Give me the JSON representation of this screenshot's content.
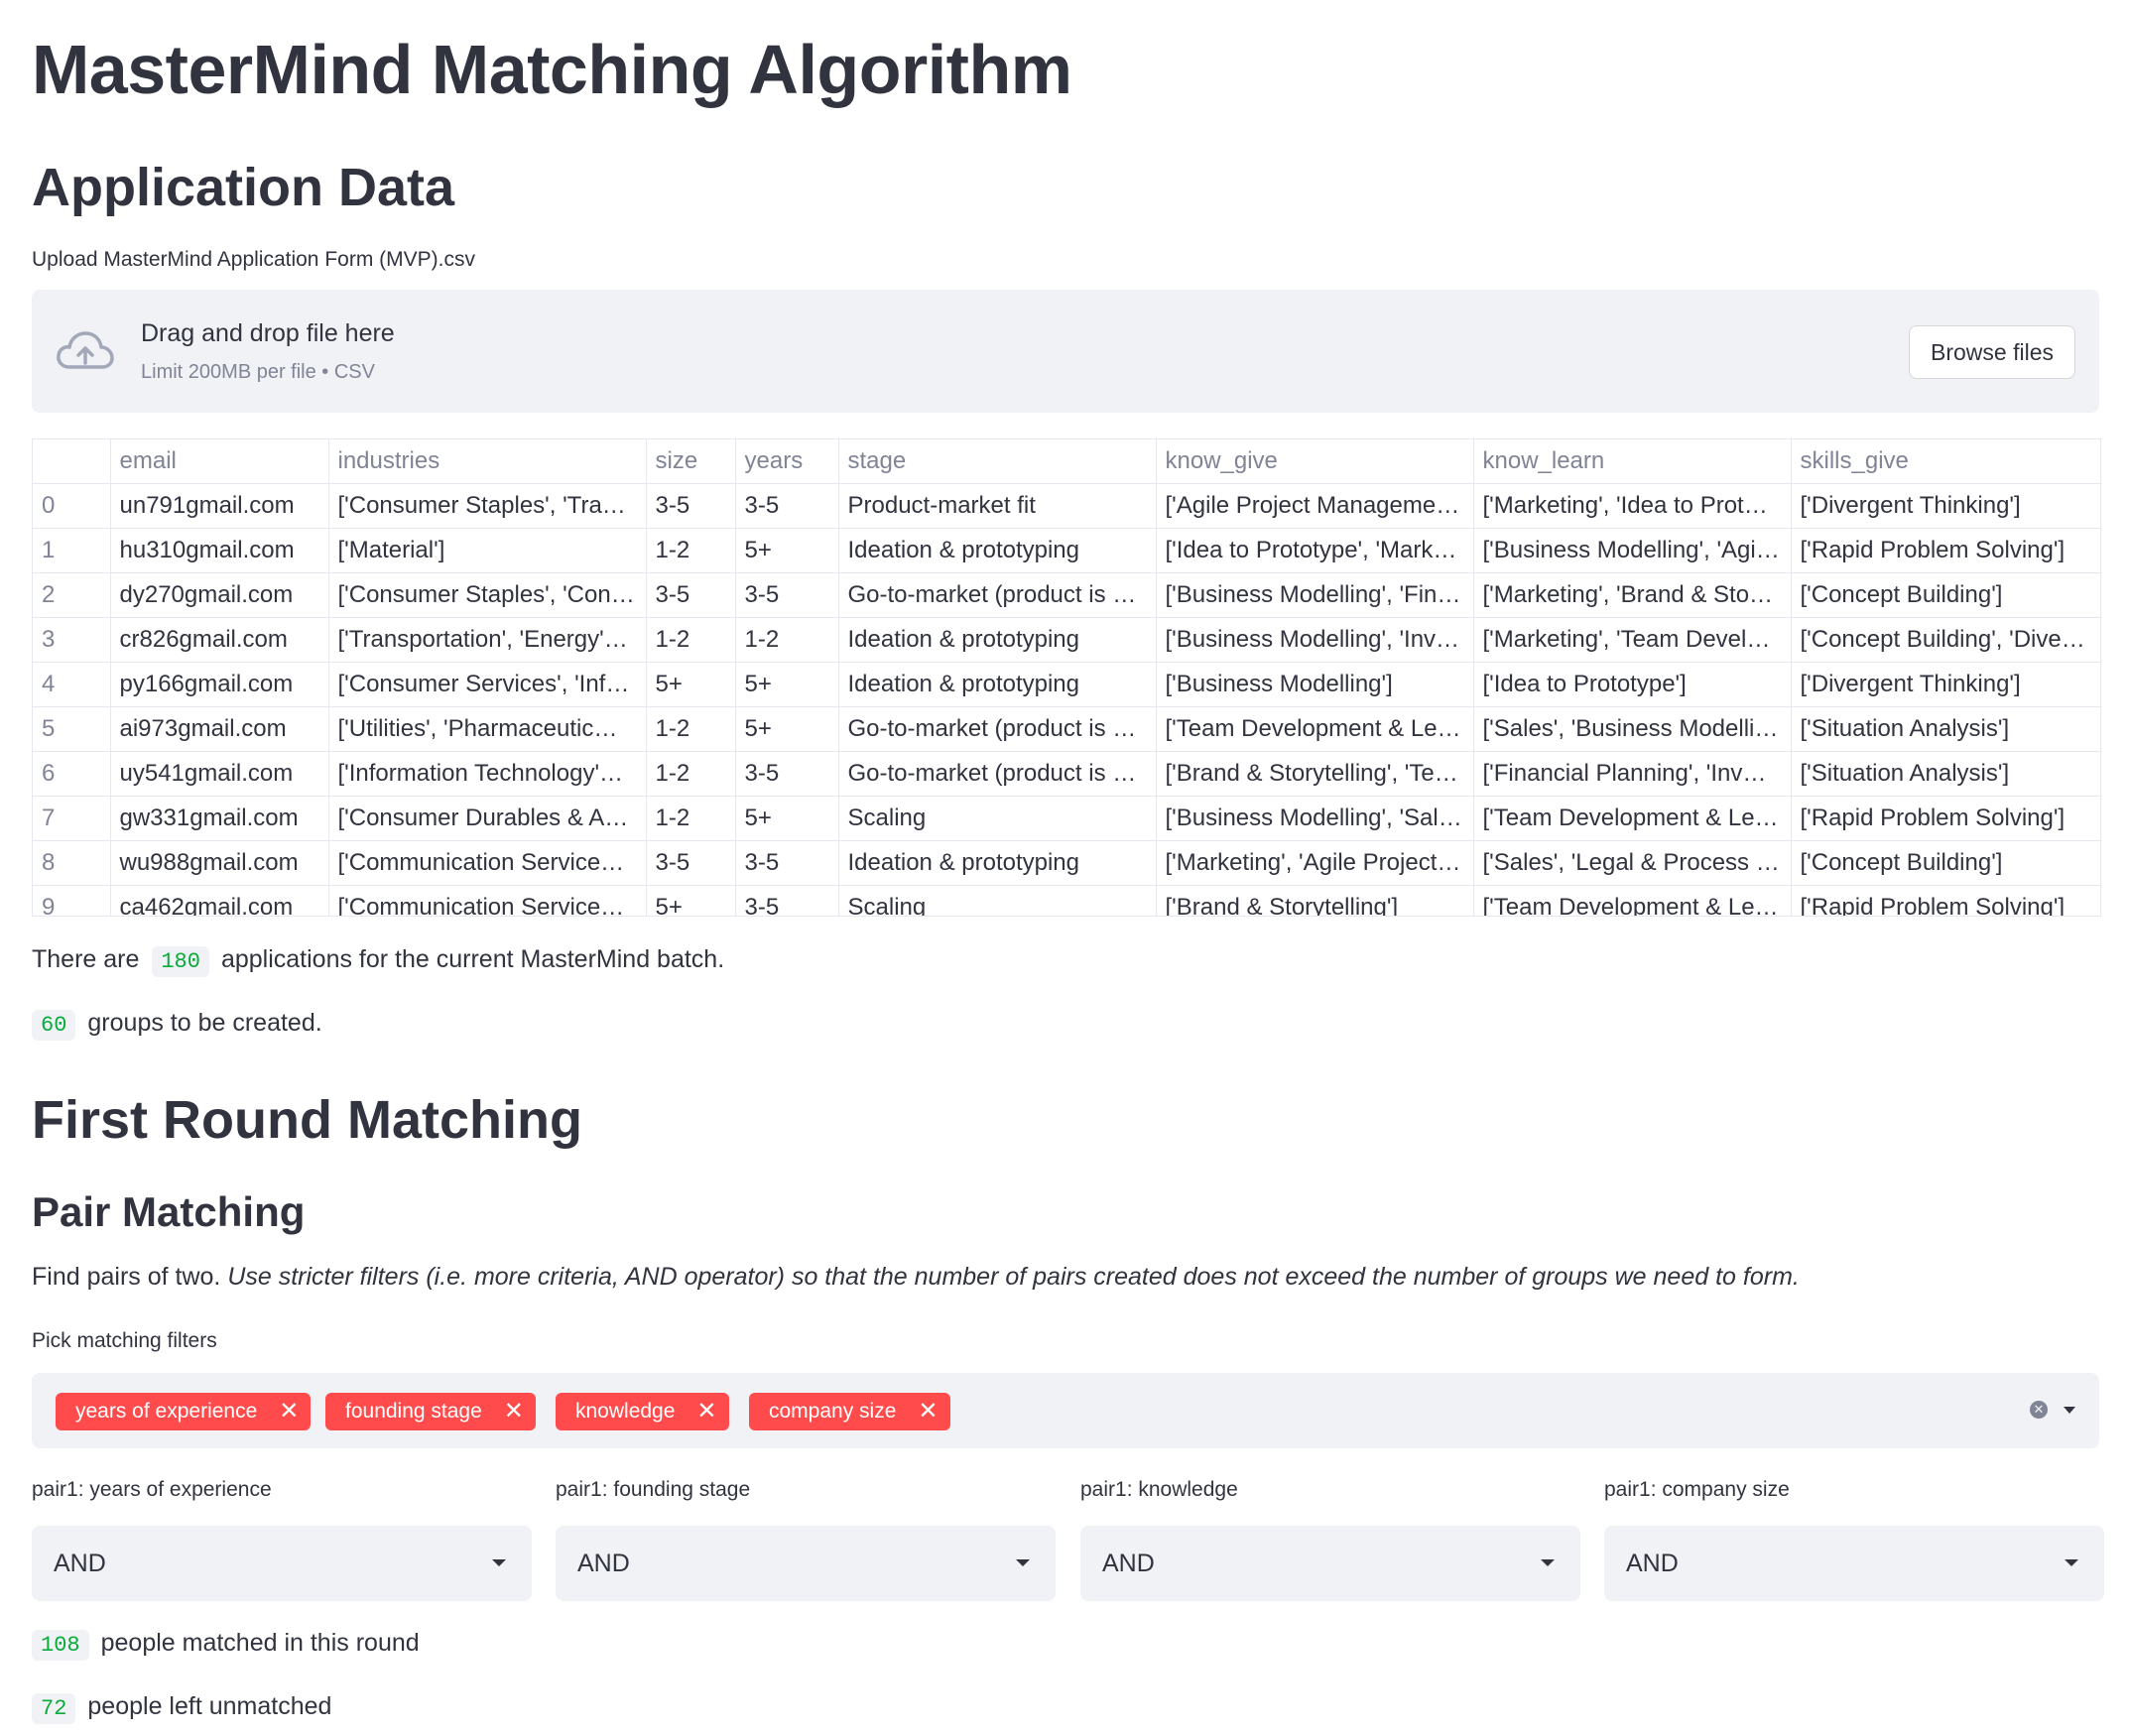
{
  "page": {
    "title": "MasterMind Matching Algorithm",
    "section_application": "Application Data"
  },
  "uploader": {
    "label": "Upload MasterMind Application Form (MVP).csv",
    "drop_title": "Drag and drop file here",
    "drop_sub": "Limit 200MB per file • CSV",
    "browse_label": "Browse files",
    "icon": "cloud-upload-icon"
  },
  "table": {
    "columns": [
      "",
      "email",
      "industries",
      "size",
      "years",
      "stage",
      "know_give",
      "know_learn",
      "skills_give"
    ],
    "rows": [
      [
        "0",
        "un791gmail.com",
        "['Consumer Staples', 'Tra…",
        "3-5",
        "3-5",
        "Product-market fit",
        "['Agile Project Manageme…",
        "['Marketing', 'Idea to Prot…",
        "['Divergent Thinking']"
      ],
      [
        "1",
        "hu310gmail.com",
        "['Material']",
        "1-2",
        "5+",
        "Ideation & prototyping",
        "['Idea to Prototype', 'Mark…",
        "['Business Modelling', 'Agi…",
        "['Rapid Problem Solving']"
      ],
      [
        "2",
        "dy270gmail.com",
        "['Consumer Staples', 'Con…",
        "3-5",
        "3-5",
        "Go-to-market (product is …",
        "['Business Modelling', 'Fin…",
        "['Marketing', 'Brand & Sto…",
        "['Concept Building']"
      ],
      [
        "3",
        "cr826gmail.com",
        "['Transportation', 'Energy'…",
        "1-2",
        "1-2",
        "Ideation & prototyping",
        "['Business Modelling', 'Inv…",
        "['Marketing', 'Team Devel…",
        "['Concept Building', 'Diver…"
      ],
      [
        "4",
        "py166gmail.com",
        "['Consumer Services', 'Inf…",
        "5+",
        "5+",
        "Ideation & prototyping",
        "['Business Modelling']",
        "['Idea to Prototype']",
        "['Divergent Thinking']"
      ],
      [
        "5",
        "ai973gmail.com",
        "['Utilities', 'Pharmaceutic…",
        "1-2",
        "5+",
        "Go-to-market (product is …",
        "['Team Development & Le…",
        "['Sales', 'Business Modelli…",
        "['Situation Analysis']"
      ],
      [
        "6",
        "uy541gmail.com",
        "['Information Technology'…",
        "1-2",
        "3-5",
        "Go-to-market (product is …",
        "['Brand & Storytelling', 'Te…",
        "['Financial Planning', 'Inv…",
        "['Situation Analysis']"
      ],
      [
        "7",
        "gw331gmail.com",
        "['Consumer Durables & A…",
        "1-2",
        "5+",
        "Scaling",
        "['Business Modelling', 'Sal…",
        "['Team Development & Le…",
        "['Rapid Problem Solving']"
      ],
      [
        "8",
        "wu988gmail.com",
        "['Communication Service…",
        "3-5",
        "3-5",
        "Ideation & prototyping",
        "['Marketing', 'Agile Project…",
        "['Sales', 'Legal & Process …",
        "['Concept Building']"
      ],
      [
        "9",
        "ca462gmail.com",
        "['Communication Service…",
        "5+",
        "3-5",
        "Scaling",
        "['Brand & Storytelling']",
        "['Team Development & Le…",
        "['Rapid Problem Solving']"
      ]
    ]
  },
  "stats": {
    "applications_prefix": "There are",
    "applications_count": "180",
    "applications_suffix": "applications for the current MasterMind batch.",
    "groups_count": "60",
    "groups_suffix": "groups to be created."
  },
  "first_round": {
    "title": "First Round Matching",
    "subtitle": "Pair Matching",
    "desc_plain": "Find pairs of two.",
    "desc_italic": "Use stricter filters (i.e. more criteria, AND operator) so that the number of pairs created does not exceed the number of groups we need to form.",
    "filters_label": "Pick matching filters",
    "filters": [
      "years of experience",
      "founding stage",
      "knowledge",
      "company size"
    ],
    "selects": [
      {
        "label": "pair1: years of experience",
        "value": "AND"
      },
      {
        "label": "pair1: founding stage",
        "value": "AND"
      },
      {
        "label": "pair1: knowledge",
        "value": "AND"
      },
      {
        "label": "pair1: company size",
        "value": "AND"
      }
    ],
    "matched_count": "108",
    "matched_suffix": "people matched in this round",
    "unmatched_count": "72",
    "unmatched_suffix": "people left unmatched"
  },
  "colors": {
    "accent": "#ff4b4b",
    "code_green": "#09ab3b",
    "panel_bg": "#f0f2f6",
    "text": "#31333f"
  }
}
